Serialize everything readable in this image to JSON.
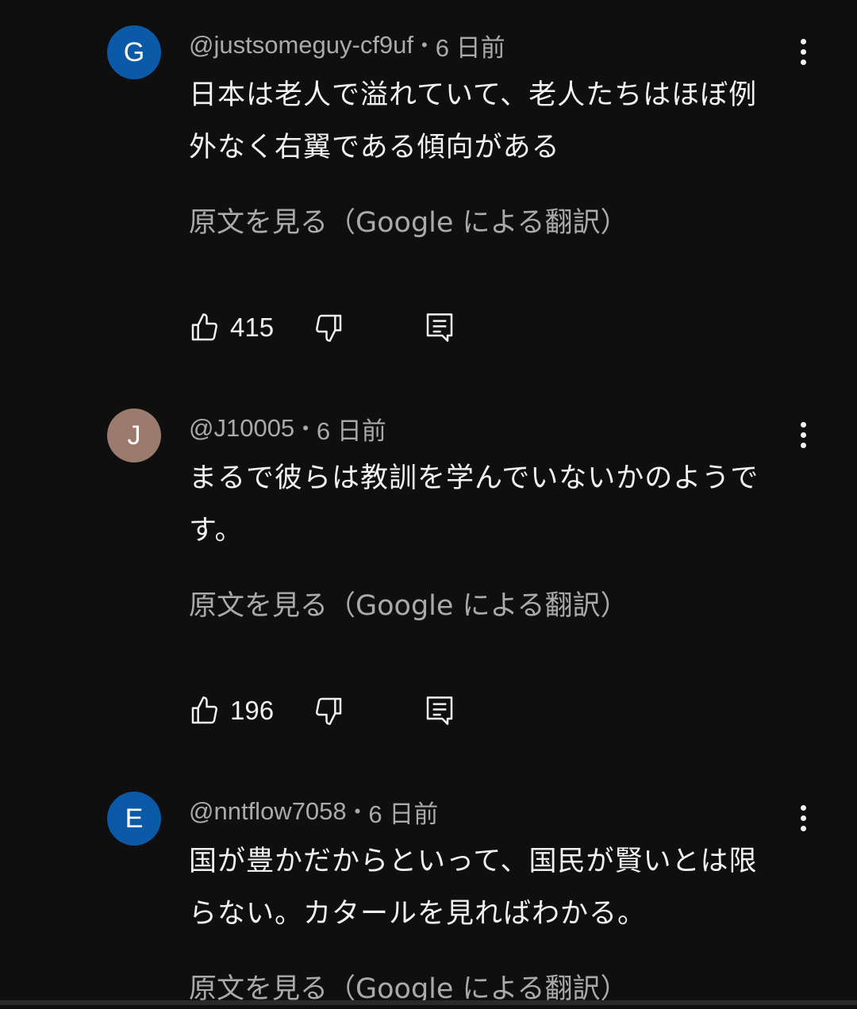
{
  "comments": [
    {
      "avatar_letter": "G",
      "avatar_color": "#0b5aa8",
      "username": "@justsomeguy-cf9uf",
      "time": "6 日前",
      "text_lines": [
        "日本は老人で溢れていて、老人たちはほぼ例",
        "外なく右翼である傾向がある"
      ],
      "translate_link": "原文を見る（Google による翻訳）",
      "likes": "415"
    },
    {
      "avatar_letter": "J",
      "avatar_color": "#9c7b6f",
      "username": "@J10005",
      "time": "6 日前",
      "text_lines": [
        "まるで彼らは教訓を学んでいないかのようで",
        "す。"
      ],
      "translate_link": "原文を見る（Google による翻訳）",
      "likes": "196"
    },
    {
      "avatar_letter": "E",
      "avatar_color": "#0b5aa8",
      "username": "@nntflow7058",
      "time": "6 日前",
      "text_lines": [
        "国が豊かだからといって、国民が賢いとは限",
        "らない。カタールを見ればわかる。"
      ],
      "translate_link": "原文を見る（Google による翻訳）"
    }
  ],
  "icons": {
    "like": "thumb-up-icon",
    "dislike": "thumb-down-icon",
    "reply": "reply-comment-icon",
    "more": "more-vertical-icon"
  }
}
